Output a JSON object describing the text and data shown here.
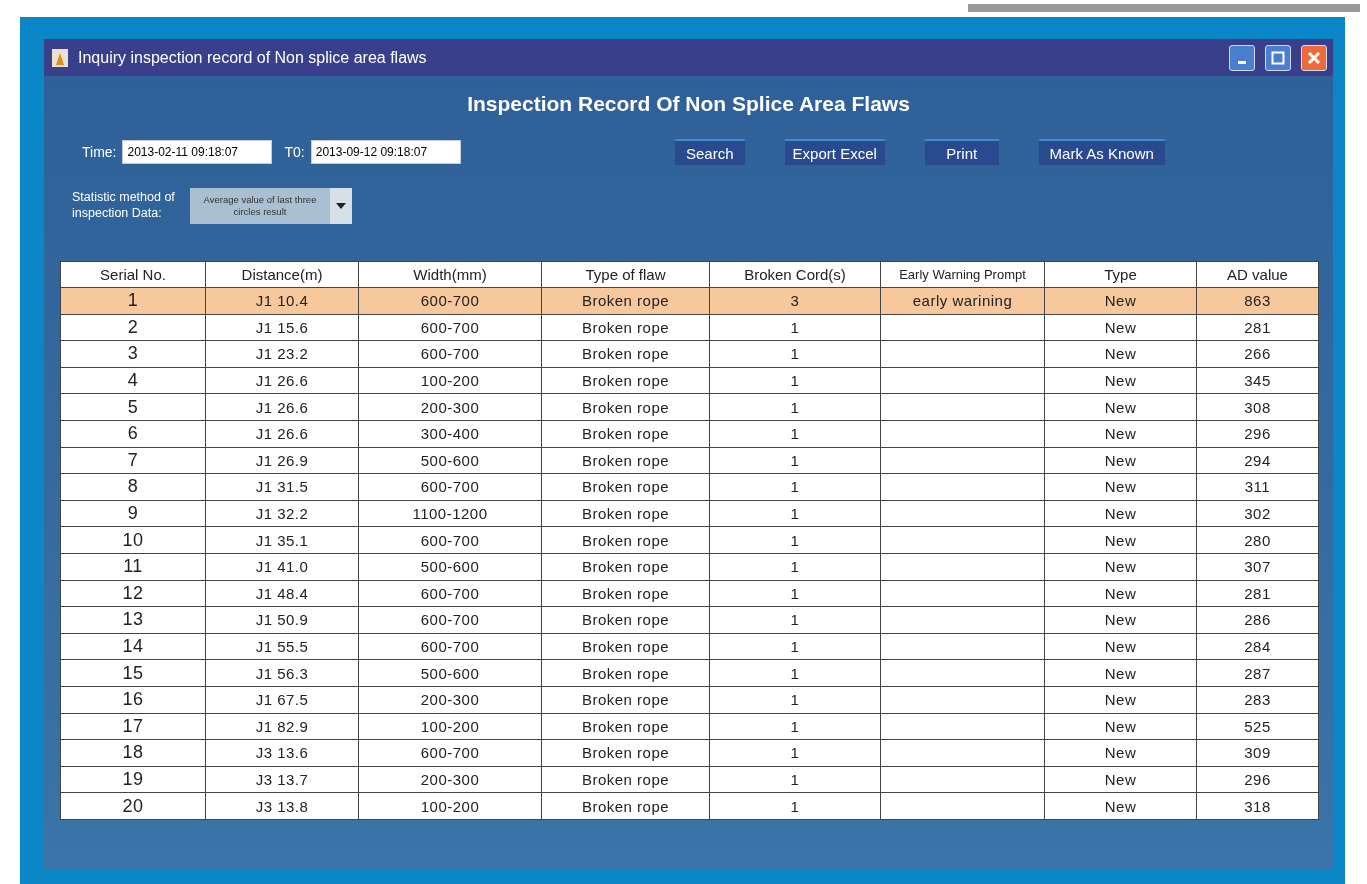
{
  "window": {
    "title": "Inquiry inspection record of Non splice area flaws"
  },
  "heading": "Inspection Record Of Non Splice Area Flaws",
  "filters": {
    "from_label": "Time:",
    "from_value": "2013-02-11 09:18:07",
    "to_label": "T0:",
    "to_value": "2013-09-12 09:18:07"
  },
  "buttons": [
    "Search",
    "Export Excel",
    "Print",
    "Mark As Known"
  ],
  "statistic": {
    "label": "Statistic method of inspection Data:",
    "value": "Average value of last three circles result"
  },
  "table": {
    "columns": [
      "Serial No.",
      "Distance(m)",
      "Width(mm)",
      "Type of flaw",
      "Broken Cord(s)",
      "Early Warning Prompt",
      "Type",
      "AD value"
    ],
    "rows": [
      {
        "selected": true,
        "cells": [
          "1",
          "J1 10.4",
          "600-700",
          "Broken rope",
          "3",
          "early warining",
          "New",
          "863"
        ]
      },
      {
        "selected": false,
        "cells": [
          "2",
          "J1 15.6",
          "600-700",
          "Broken rope",
          "1",
          "",
          "New",
          "281"
        ]
      },
      {
        "selected": false,
        "cells": [
          "3",
          "J1 23.2",
          "600-700",
          "Broken rope",
          "1",
          "",
          "New",
          "266"
        ]
      },
      {
        "selected": false,
        "cells": [
          "4",
          "J1 26.6",
          "100-200",
          "Broken rope",
          "1",
          "",
          "New",
          "345"
        ]
      },
      {
        "selected": false,
        "cells": [
          "5",
          "J1 26.6",
          "200-300",
          "Broken rope",
          "1",
          "",
          "New",
          "308"
        ]
      },
      {
        "selected": false,
        "cells": [
          "6",
          "J1 26.6",
          "300-400",
          "Broken rope",
          "1",
          "",
          "New",
          "296"
        ]
      },
      {
        "selected": false,
        "cells": [
          "7",
          "J1 26.9",
          "500-600",
          "Broken rope",
          "1",
          "",
          "New",
          "294"
        ]
      },
      {
        "selected": false,
        "cells": [
          "8",
          "J1 31.5",
          "600-700",
          "Broken rope",
          "1",
          "",
          "New",
          "311"
        ]
      },
      {
        "selected": false,
        "cells": [
          "9",
          "J1 32.2",
          "1100-1200",
          "Broken rope",
          "1",
          "",
          "New",
          "302"
        ]
      },
      {
        "selected": false,
        "cells": [
          "10",
          "J1 35.1",
          "600-700",
          "Broken rope",
          "1",
          "",
          "New",
          "280"
        ]
      },
      {
        "selected": false,
        "cells": [
          "11",
          "J1 41.0",
          "500-600",
          "Broken rope",
          "1",
          "",
          "New",
          "307"
        ]
      },
      {
        "selected": false,
        "cells": [
          "12",
          "J1 48.4",
          "600-700",
          "Broken rope",
          "1",
          "",
          "New",
          "281"
        ]
      },
      {
        "selected": false,
        "cells": [
          "13",
          "J1 50.9",
          "600-700",
          "Broken rope",
          "1",
          "",
          "New",
          "286"
        ]
      },
      {
        "selected": false,
        "cells": [
          "14",
          "J1 55.5",
          "600-700",
          "Broken rope",
          "1",
          "",
          "New",
          "284"
        ]
      },
      {
        "selected": false,
        "cells": [
          "15",
          "J1 56.3",
          "500-600",
          "Broken rope",
          "1",
          "",
          "New",
          "287"
        ]
      },
      {
        "selected": false,
        "cells": [
          "16",
          "J1 67.5",
          "200-300",
          "Broken rope",
          "1",
          "",
          "New",
          "283"
        ]
      },
      {
        "selected": false,
        "cells": [
          "17",
          "J1 82.9",
          "100-200",
          "Broken rope",
          "1",
          "",
          "New",
          "525"
        ]
      },
      {
        "selected": false,
        "cells": [
          "18",
          "J3 13.6",
          "600-700",
          "Broken rope",
          "1",
          "",
          "New",
          "309"
        ]
      },
      {
        "selected": false,
        "cells": [
          "19",
          "J3 13.7",
          "200-300",
          "Broken rope",
          "1",
          "",
          "New",
          "296"
        ]
      },
      {
        "selected": false,
        "cells": [
          "20",
          "J3 13.8",
          "100-200",
          "Broken rope",
          "1",
          "",
          "New",
          "318"
        ]
      }
    ]
  }
}
